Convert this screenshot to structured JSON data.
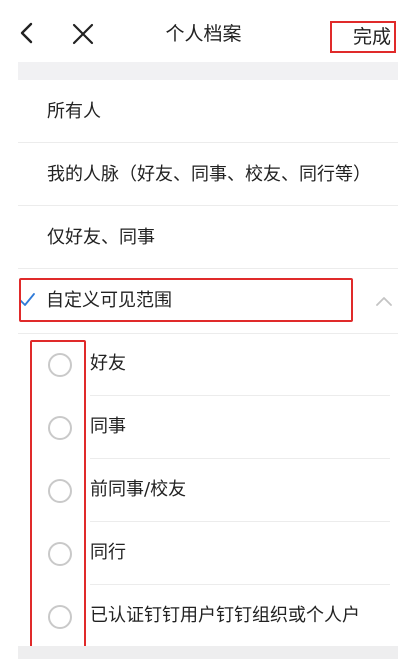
{
  "header": {
    "back_icon": "back-arrow-icon",
    "close_icon": "close-icon",
    "title": "个人档案",
    "done_label": "完成"
  },
  "visibility_options": [
    {
      "label": "所有人"
    },
    {
      "label": "我的人脉（好友、同事、校友、同行等）"
    },
    {
      "label": "仅好友、同事"
    }
  ],
  "custom_scope": {
    "label": "自定义可见范围",
    "checked": true,
    "expanded": true,
    "check_icon": "checkmark-icon",
    "chevron_icon": "chevron-up-icon"
  },
  "custom_options": [
    {
      "label": "好友",
      "selected": false
    },
    {
      "label": "同事",
      "selected": false
    },
    {
      "label": "前同事/校友",
      "selected": false
    },
    {
      "label": "同行",
      "selected": false
    },
    {
      "label": "已认证钉钉用户钉钉组织或个人户",
      "selected": false
    }
  ],
  "colors": {
    "highlight": "#e02a2a",
    "accent": "#2f7ad8",
    "radio_border": "#c9c9c9",
    "divider": "#ececec",
    "gap": "#f1f1f3"
  }
}
